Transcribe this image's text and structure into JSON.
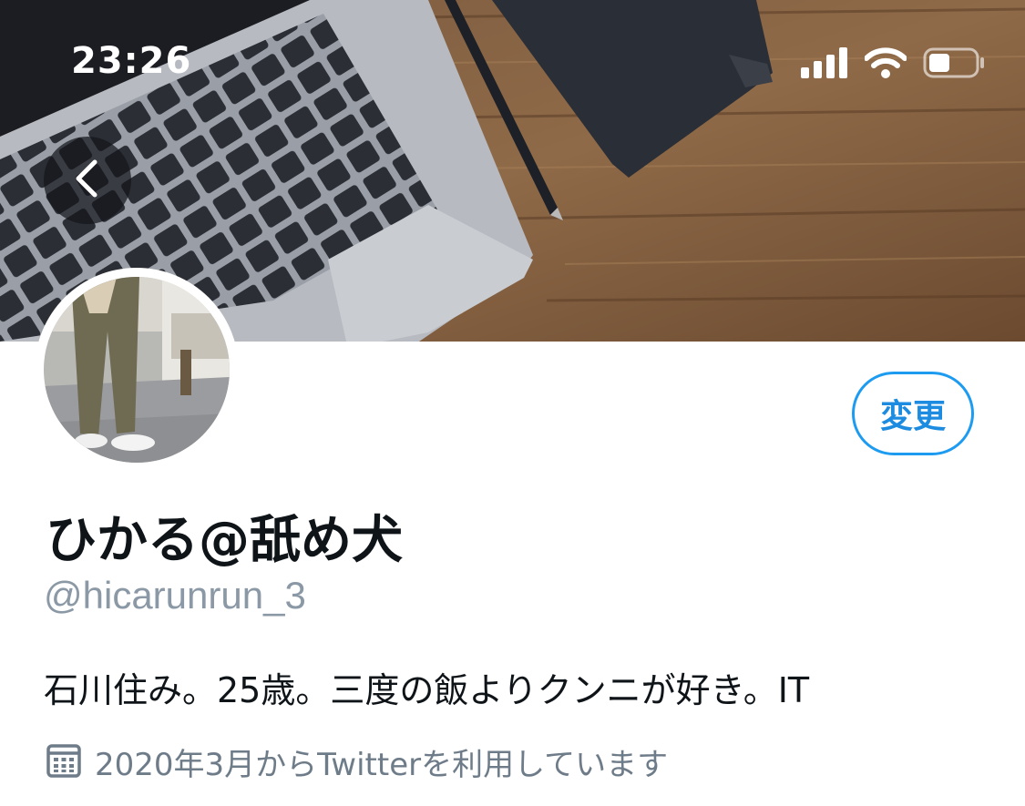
{
  "status_bar": {
    "time": "23:26",
    "icons": [
      "cellular-signal-icon",
      "wifi-icon",
      "battery-icon"
    ]
  },
  "header": {
    "back_icon": "chevron-left-icon",
    "banner": "desk-laptop-notebook-pen-photo"
  },
  "profile": {
    "avatar": "person-legs-photo",
    "edit_label": "変更",
    "display_name": "ひかる@舐め犬",
    "handle": "@hicarunrun_3",
    "bio": "石川住み。25歳。三度の飯よりクンニが好き。IT",
    "joined_icon": "calendar-icon",
    "joined": "2020年3月からTwitterを利用しています"
  },
  "colors": {
    "accent": "#1d9bf0",
    "text_primary": "#0f1419",
    "text_secondary": "#8b98a5"
  }
}
